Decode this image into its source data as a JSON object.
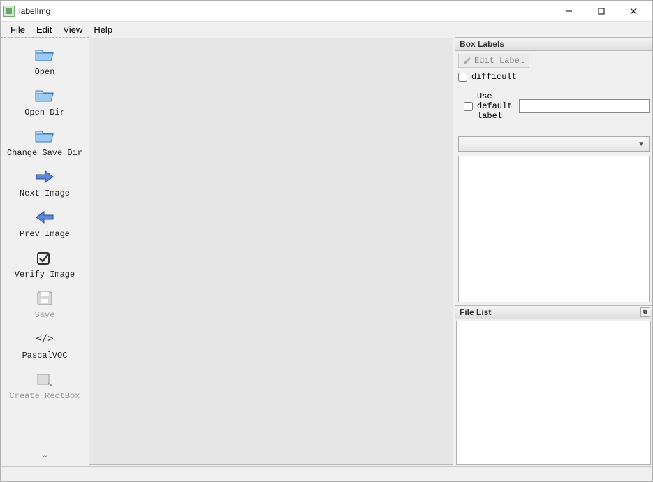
{
  "window": {
    "title": "labelImg"
  },
  "menu": {
    "file": "File",
    "edit": "Edit",
    "view": "View",
    "help": "Help"
  },
  "toolbar": {
    "open": "Open",
    "open_dir": "Open Dir",
    "change_save_dir": "Change Save Dir",
    "next_image": "Next Image",
    "prev_image": "Prev Image",
    "verify_image": "Verify Image",
    "save": "Save",
    "format": "PascalVOC",
    "format_code": "</>",
    "create_rectbox": "Create RectBox"
  },
  "panels": {
    "box_labels": {
      "title": "Box Labels",
      "edit_label": "Edit Label",
      "difficult": "difficult",
      "use_default_label": "Use default label",
      "default_label_value": ""
    },
    "file_list": {
      "title": "File List"
    }
  }
}
